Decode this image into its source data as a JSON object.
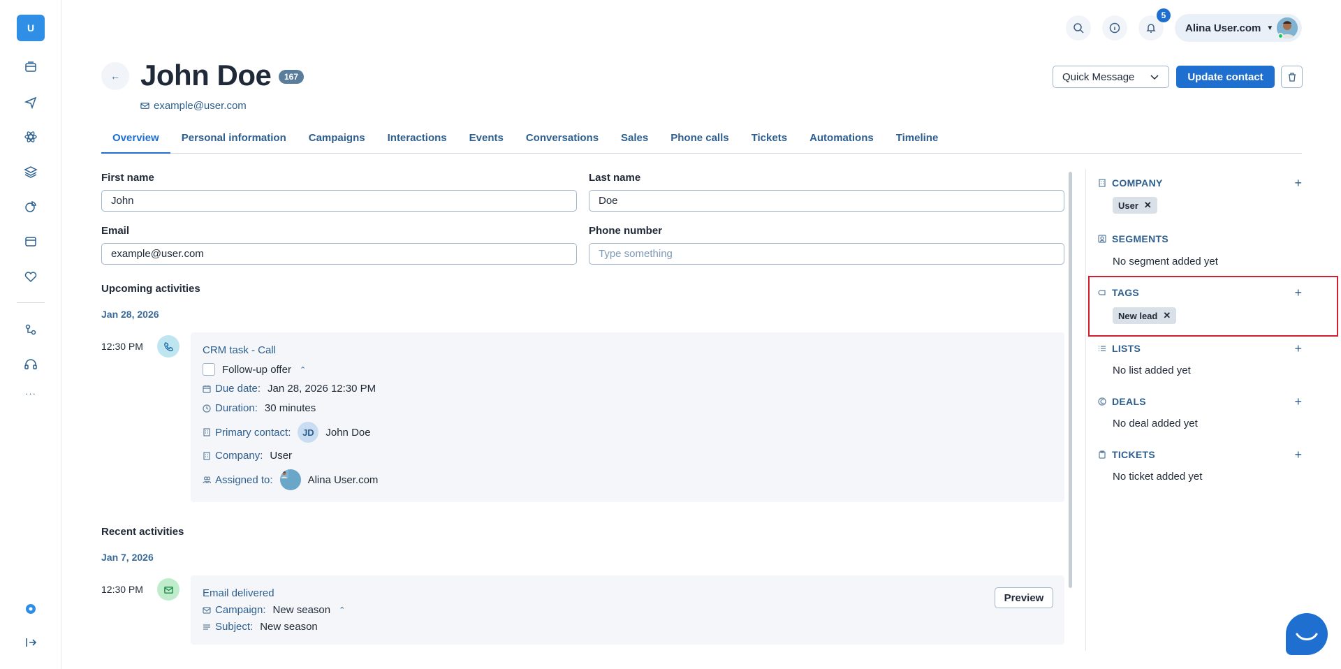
{
  "rail": {
    "logo_letter": "U",
    "more_label": "···"
  },
  "topbar": {
    "notifications_count": "5",
    "user_name": "Alina User.com"
  },
  "contact": {
    "name": "John Doe",
    "id_badge": "167",
    "email": "example@user.com"
  },
  "actions": {
    "quick_message": "Quick Message",
    "update_contact": "Update contact"
  },
  "tabs": [
    {
      "label": "Overview",
      "active": true
    },
    {
      "label": "Personal information"
    },
    {
      "label": "Campaigns"
    },
    {
      "label": "Interactions"
    },
    {
      "label": "Events"
    },
    {
      "label": "Conversations"
    },
    {
      "label": "Sales"
    },
    {
      "label": "Phone calls"
    },
    {
      "label": "Tickets"
    },
    {
      "label": "Automations"
    },
    {
      "label": "Timeline"
    }
  ],
  "form": {
    "first_name_label": "First name",
    "first_name_value": "John",
    "last_name_label": "Last name",
    "last_name_value": "Doe",
    "email_label": "Email",
    "email_value": "example@user.com",
    "phone_label": "Phone number",
    "phone_placeholder": "Type something"
  },
  "upcoming": {
    "title": "Upcoming activities",
    "date": "Jan 28, 2026",
    "time": "12:30 PM",
    "card": {
      "title": "CRM task - Call",
      "task": "Follow-up offer",
      "due_label": "Due date:",
      "due_value": "Jan 28, 2026 12:30 PM",
      "duration_label": "Duration:",
      "duration_value": "30 minutes",
      "primary_label": "Primary contact:",
      "primary_initials": "JD",
      "primary_value": "John Doe",
      "company_label": "Company:",
      "company_value": "User",
      "assigned_label": "Assigned to:",
      "assigned_value": "Alina User.com"
    }
  },
  "recent": {
    "title": "Recent activities",
    "date": "Jan 7, 2026",
    "time": "12:30 PM",
    "card": {
      "title": "Email delivered",
      "campaign_label": "Campaign:",
      "campaign_value": "New season",
      "subject_label": "Subject:",
      "subject_value": "New season",
      "preview_label": "Preview"
    }
  },
  "panel": {
    "company": {
      "title": "COMPANY",
      "chip": "User"
    },
    "segments": {
      "title": "SEGMENTS",
      "empty": "No segment added yet"
    },
    "tags": {
      "title": "TAGS",
      "chip": "New lead"
    },
    "lists": {
      "title": "LISTS",
      "empty": "No list added yet"
    },
    "deals": {
      "title": "DEALS",
      "empty": "No deal added yet"
    },
    "tickets": {
      "title": "TICKETS",
      "empty": "No ticket added yet"
    }
  },
  "colors": {
    "accent": "#1f6fd1",
    "link": "#2d5e8e",
    "highlight_box": "#d11f2f"
  }
}
